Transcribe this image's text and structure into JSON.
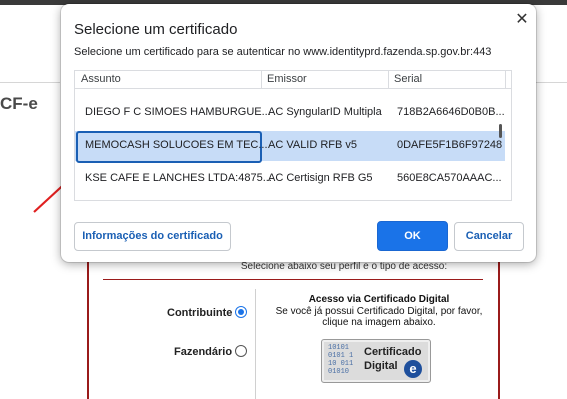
{
  "background": {
    "brand_fragment": "CF-e",
    "cut_text": "Selecione abaixo seu perfil e o tipo de acesso:",
    "options": [
      {
        "label": "Contribuinte",
        "selected": true
      },
      {
        "label": "Fazendário",
        "selected": false
      }
    ],
    "access_title": "Acesso via Certificado Digital",
    "access_text_1": "Se você já possui Certificado Digital, por favor,",
    "access_text_2": "clique na imagem abaixo.",
    "cert_image_word1": "Certificado",
    "cert_image_word2": "Digital",
    "cert_image_e": "e",
    "colors": {
      "panel_border": "#9a1b1b",
      "radio_selected": "#1a73e8"
    }
  },
  "dialog": {
    "title": "Selecione um certificado",
    "close_icon": "close-icon",
    "subtitle": "Selecione um certificado para se autenticar no www.identityprd.fazenda.sp.gov.br:443",
    "columns": [
      "Assunto",
      "Emissor",
      "Serial"
    ],
    "rows": [
      {
        "subject": "DIEGO F C SIMOES HAMBURGUE...",
        "issuer": "AC SyngularID Multipla",
        "serial": "718B2A6646D0B0B...",
        "selected": false
      },
      {
        "subject": "MEMOCASH SOLUCOES EM TEC...",
        "issuer": "AC VALID RFB v5",
        "serial": "0DAFE5F1B6F97248",
        "selected": true
      },
      {
        "subject": "KSE CAFE E LANCHES LTDA:4875...",
        "issuer": "AC Certisign RFB G5",
        "serial": "560E8CA570AAAC...",
        "selected": false
      }
    ],
    "buttons": {
      "info": "Informações do certificado",
      "ok": "OK",
      "cancel": "Cancelar"
    },
    "colors": {
      "selected_row": "#c7dcf7",
      "primary": "#1a73e8",
      "annotation_arrow": "#e02020"
    }
  }
}
